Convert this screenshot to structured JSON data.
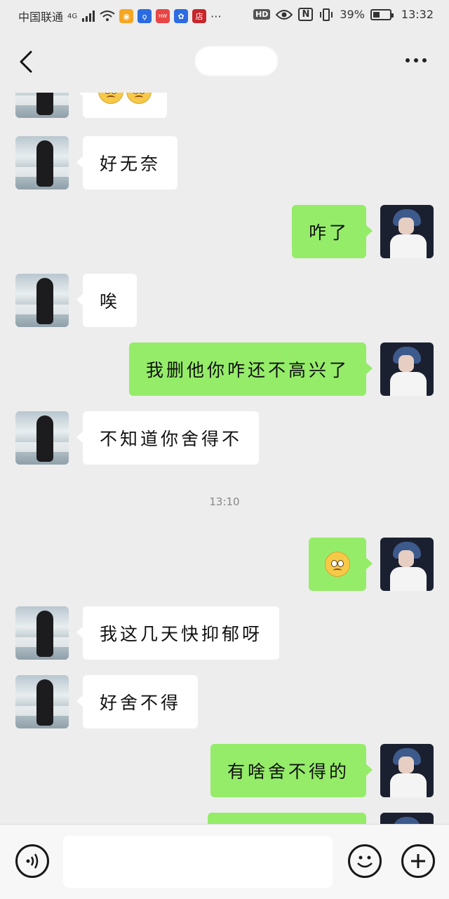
{
  "status_bar": {
    "carrier": "中国联通",
    "network": "4G",
    "battery_percent": "39%",
    "time": "13:32",
    "hd_label": "HD",
    "nfc_label": "N",
    "app_icons": [
      "weibo-icon",
      "bulb-app-icon",
      "huawei-app-icon",
      "baidu-icon",
      "store-icon"
    ],
    "store_label": "店",
    "more_label": "···"
  },
  "nav": {
    "back_icon": "chevron-left-icon",
    "more_icon": "more-dots-icon"
  },
  "messages": [
    {
      "side": "in",
      "content": "",
      "emoji": "loudly-crying-face-x2",
      "partial": true
    },
    {
      "side": "in",
      "content": "好无奈"
    },
    {
      "side": "out",
      "content": "咋了"
    },
    {
      "side": "in",
      "content": "唉"
    },
    {
      "side": "out",
      "content": "我删他你咋还不高兴了"
    },
    {
      "side": "in",
      "content": "不知道你舍得不"
    },
    {
      "timestamp": "13:10"
    },
    {
      "side": "out",
      "content": "",
      "emoji": "pleading-face"
    },
    {
      "side": "in",
      "content": "我这几天快抑郁呀"
    },
    {
      "side": "in",
      "content": "好舍不得"
    },
    {
      "side": "out",
      "content": "有啥舍不得的"
    },
    {
      "side": "out",
      "content": "",
      "partial": true
    }
  ],
  "colors": {
    "background": "#ededed",
    "outgoing_bubble": "#95ec69",
    "incoming_bubble": "#ffffff"
  },
  "input": {
    "value": "",
    "placeholder": ""
  }
}
